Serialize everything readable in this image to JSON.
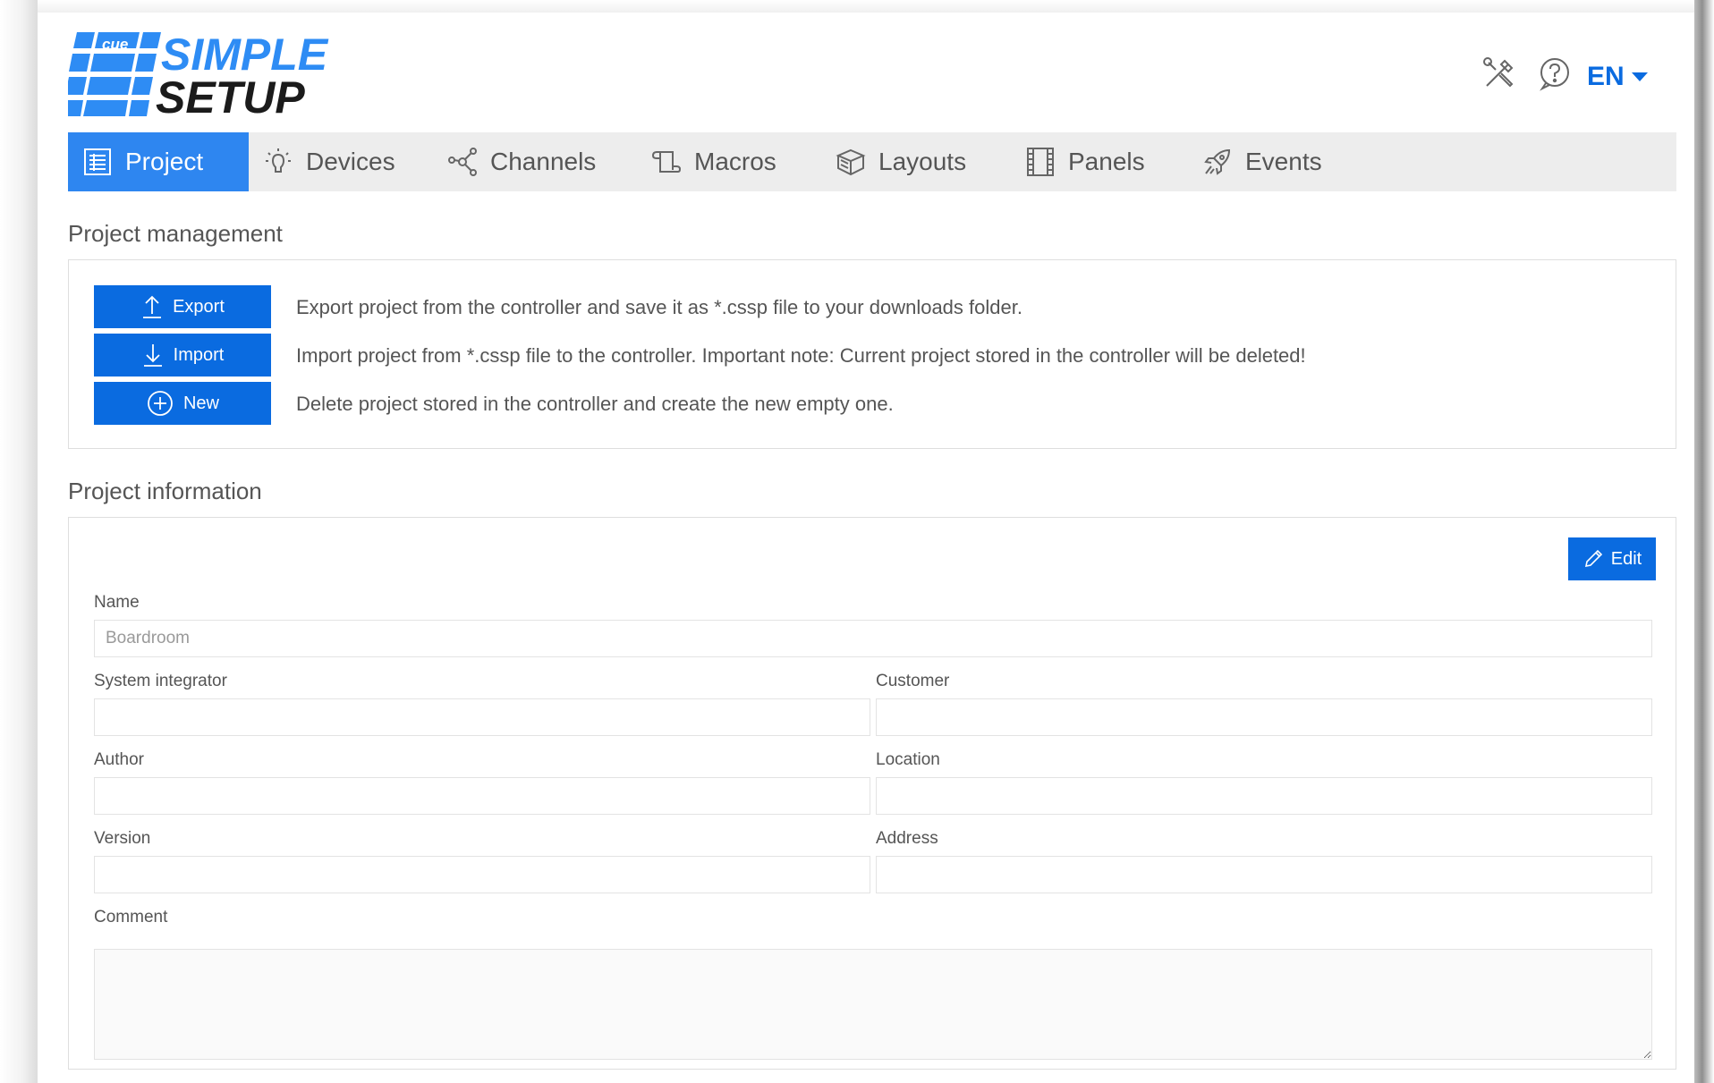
{
  "header": {
    "logo": {
      "badge": "cue",
      "line1": "SIMPLE",
      "line2": "SETUP"
    },
    "tools_icon": "tools-icon",
    "help_icon": "help-circle-icon",
    "language": "EN"
  },
  "tabs": [
    {
      "label": "Project",
      "icon": "project-list-icon",
      "active": true
    },
    {
      "label": "Devices",
      "icon": "lightbulb-icon",
      "active": false
    },
    {
      "label": "Channels",
      "icon": "network-nodes-icon",
      "active": false
    },
    {
      "label": "Macros",
      "icon": "scroll-icon",
      "active": false
    },
    {
      "label": "Layouts",
      "icon": "cube-icon",
      "active": false
    },
    {
      "label": "Panels",
      "icon": "film-panel-icon",
      "active": false
    },
    {
      "label": "Events",
      "icon": "rocket-icon",
      "active": false
    }
  ],
  "management": {
    "title": "Project management",
    "actions": [
      {
        "label": "Export",
        "icon": "upload-arrow-icon",
        "description": "Export project from the controller and save it as *.cssp file to your downloads folder."
      },
      {
        "label": "Import",
        "icon": "download-arrow-icon",
        "description": "Import project from *.cssp file to the controller. Important note: Current project stored in the controller will be deleted!"
      },
      {
        "label": "New",
        "icon": "plus-circle-icon",
        "description": "Delete project stored in the controller and create the new empty one."
      }
    ]
  },
  "information": {
    "title": "Project information",
    "edit_label": "Edit",
    "fields": {
      "name": {
        "label": "Name",
        "value": "Boardroom"
      },
      "system_integrator": {
        "label": "System integrator",
        "value": ""
      },
      "customer": {
        "label": "Customer",
        "value": ""
      },
      "author": {
        "label": "Author",
        "value": ""
      },
      "location": {
        "label": "Location",
        "value": ""
      },
      "version": {
        "label": "Version",
        "value": ""
      },
      "address": {
        "label": "Address",
        "value": ""
      },
      "comment": {
        "label": "Comment",
        "value": ""
      }
    }
  },
  "colors": {
    "accent": "#0a6be0",
    "active_tab": "#2e86f0",
    "tab_bar": "#ededed",
    "logo_blue": "#2e8cf4"
  }
}
